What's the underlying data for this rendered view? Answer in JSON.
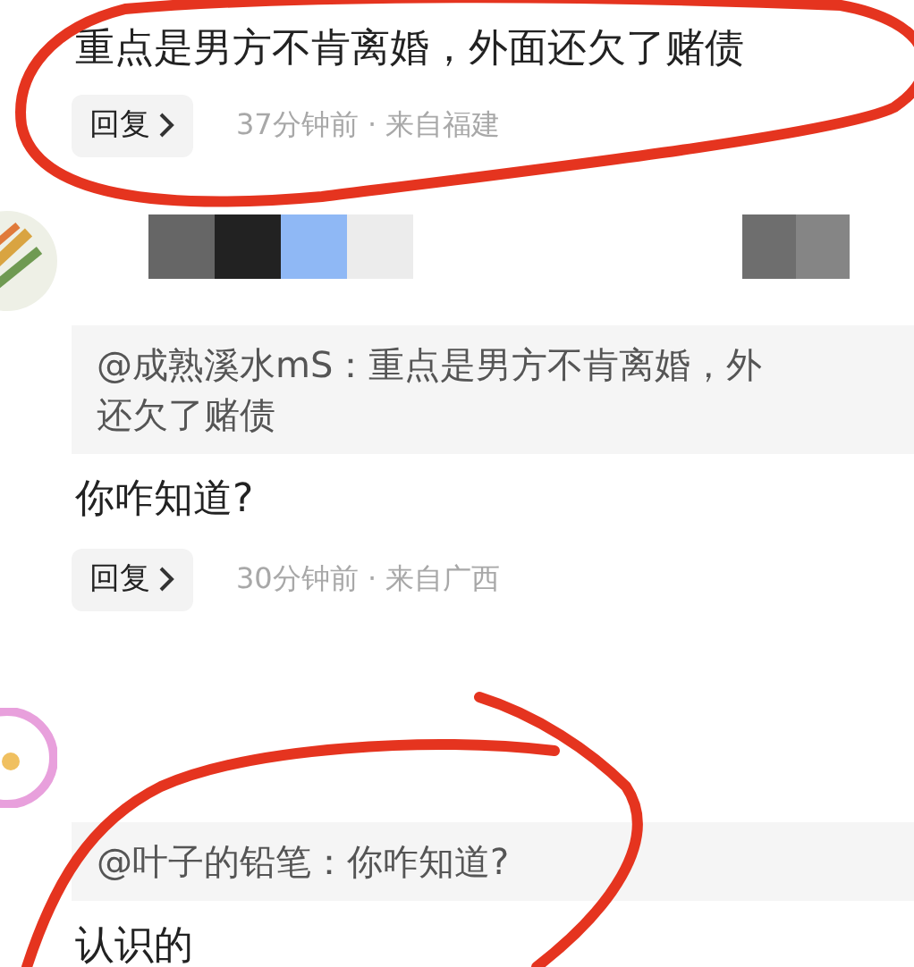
{
  "thread": [
    {
      "kind": "tail",
      "text": "重点是男方不肯离婚，外面还欠了赌债",
      "reply_button": "回复",
      "meta": "37分钟前 · 来自福建"
    },
    {
      "kind": "reply",
      "quote_lines": [
        "@成熟溪水mS：重点是男方不肯离婚，外",
        "还欠了赌债"
      ],
      "text": "你咋知道?",
      "reply_button": "回复",
      "meta": "30分钟前 · 来自广西"
    },
    {
      "kind": "reply",
      "quote_lines": [
        "@叶子的铅笔：你咋知道?"
      ],
      "text": "认识的"
    }
  ]
}
